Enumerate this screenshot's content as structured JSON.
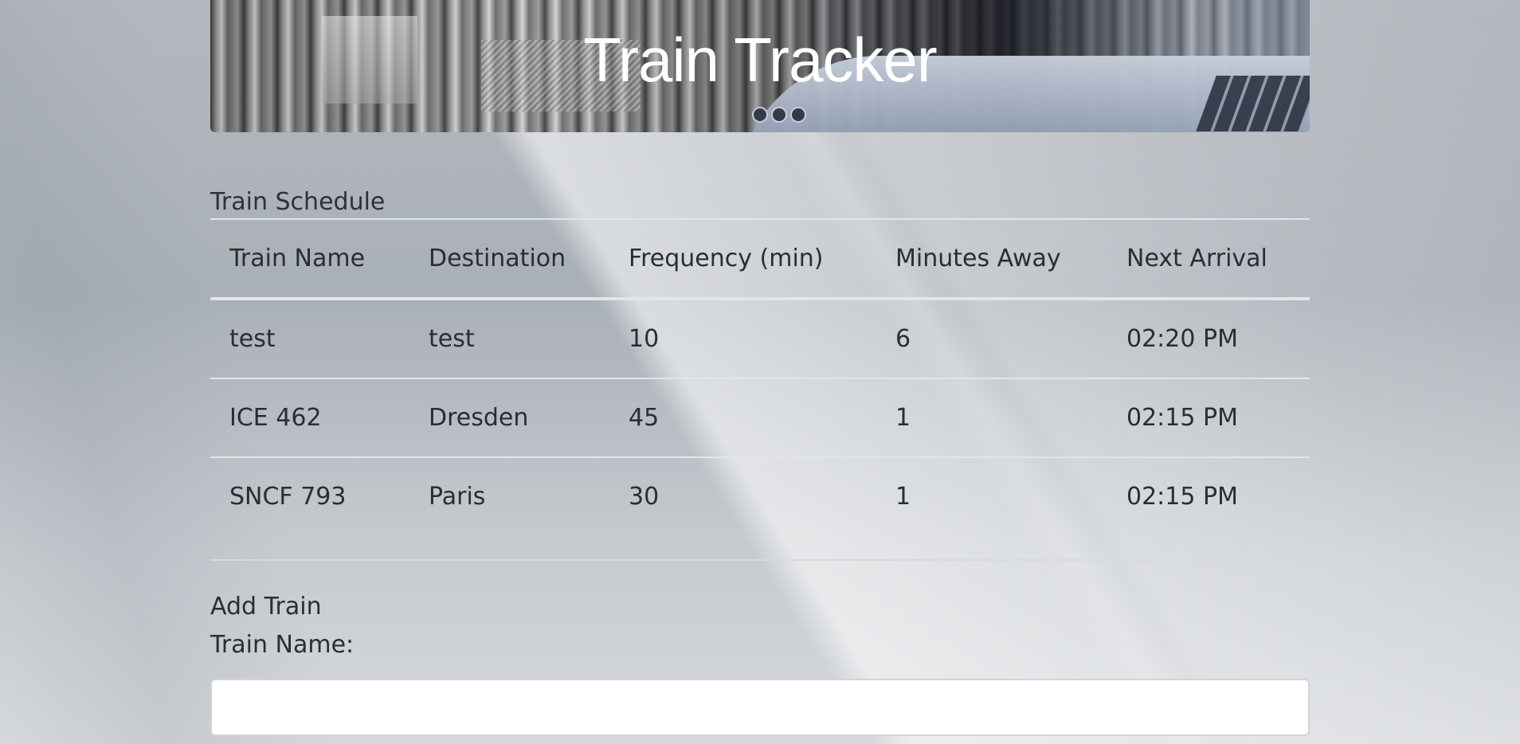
{
  "header": {
    "title": "Train Tracker"
  },
  "schedule": {
    "title": "Train Schedule",
    "columns": [
      "Train Name",
      "Destination",
      "Frequency (min)",
      "Minutes Away",
      "Next Arrival"
    ],
    "rows": [
      [
        "test",
        "test",
        "10",
        "6",
        "02:20 PM"
      ],
      [
        "ICE 462",
        "Dresden",
        "45",
        "1",
        "02:15 PM"
      ],
      [
        "SNCF 793",
        "Paris",
        "30",
        "1",
        "02:15 PM"
      ]
    ]
  },
  "add_train": {
    "title": "Add Train",
    "train_name_label": "Train Name:",
    "train_name_value": "",
    "train_name_placeholder": ""
  }
}
